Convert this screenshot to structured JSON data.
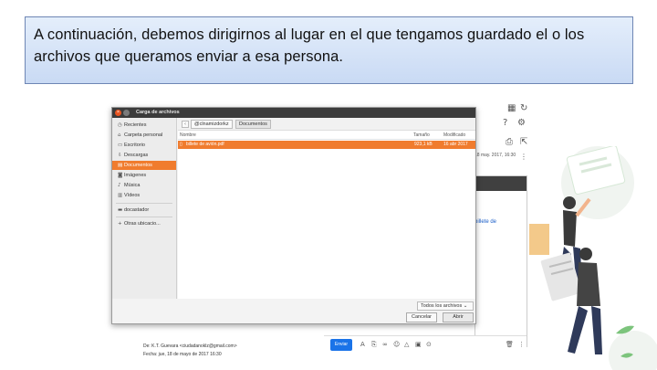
{
  "caption": {
    "line1": "A continuación, debemos dirigirnos al lugar en el que tengamos guardado el o los",
    "line2": "archivos que queramos enviar a esa persona."
  },
  "dialog": {
    "title": "Carga de archivos",
    "sidebar": [
      {
        "label": "Recientes",
        "icon": "clock-icon"
      },
      {
        "label": "Carpeta personal",
        "icon": "home-icon"
      },
      {
        "label": "Escritorio",
        "icon": "folder-icon"
      },
      {
        "label": "Descargas",
        "icon": "download-icon"
      },
      {
        "label": "Documentos",
        "icon": "document-icon",
        "active": true
      },
      {
        "label": "Imágenes",
        "icon": "camera-icon"
      },
      {
        "label": "Música",
        "icon": "music-icon"
      },
      {
        "label": "Vídeos",
        "icon": "film-icon"
      },
      {
        "label": "docastador",
        "icon": "drive-icon"
      },
      {
        "label": "Otras ubicacio...",
        "icon": "plus-icon"
      }
    ],
    "path": [
      "@clnamizdorkz",
      "Documentos"
    ],
    "columns": {
      "name": "Nombre",
      "size": "Tamaño",
      "modified": "Modificado"
    },
    "files": [
      {
        "name": "billete de avión.pdf",
        "size": "923,1 kB",
        "modified": "16 abr 2017"
      }
    ],
    "filter": "Todos los archivos",
    "cancel_label": "Cancelar",
    "open_label": "Abrir"
  },
  "gmail": {
    "date": "18 may. 2017, 16:30",
    "link_text": "billete de",
    "send_label": "Enviar",
    "bottom_from": "De: K.T. Guevara <ciudadanoklz@gmail.com>",
    "bottom_date": "Fecha: jue, 18 de mayo de 2017 16:30"
  }
}
